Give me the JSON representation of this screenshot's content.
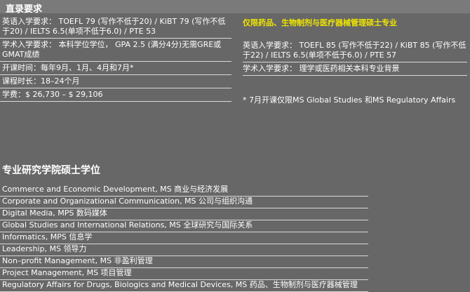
{
  "left": {
    "title": "直录要求",
    "rows": [
      "英语入学要求： TOEFL 79 (写作不低于20) / KiBT 79 (写作不低于20) / IELTS 6.5(单项不低于6.0) / PTE 53",
      "学术入学要求： 本科学位学位， GPA 2.5 (满分4分)无需GRE或GMAT成绩",
      "开课时间：每年9月、1月、4月和7月*",
      "课程时长：18–24个月",
      "学费：$ 26,730 – $ 29,106"
    ]
  },
  "right": {
    "title": "仅限药品、生物制剂与医疗器械管理硕士专业",
    "rows": [
      "英语入学要求： TOEFL 85 (写作不低于22) / KiBT 85 (写作不低于22) / IELTS 6.5(单项不低于6.0) / PTE 57",
      "学术入学要求： 理学或医药相关本科专业背景"
    ],
    "note": "* 7月开课仅限MS Global Studies 和MS Regulatory Affairs"
  },
  "degrees": {
    "title": "专业研究学院硕士学位",
    "items": [
      "Commerce and Economic Development, MS 商业与经济发展",
      "Corporate and Organizational Communication, MS 公司与组织沟通",
      "Digital Media, MPS 数码媒体",
      "Global Studies and International Relations, MS 全球研究与国际关系",
      "Informatics, MPS 信息学",
      "Leadership, MS 领导力",
      "Non–profit Management, MS 非盈利管理",
      "Project Management, MS 项目管理",
      "Regulatory Affairs for Drugs, Biologics and Medical Devices, MS 药品、生物制剂与医疗器械管理"
    ]
  },
  "colors": {
    "background": "#676767",
    "accent": "#f0e600",
    "header_bar": "#7a7a7a"
  }
}
